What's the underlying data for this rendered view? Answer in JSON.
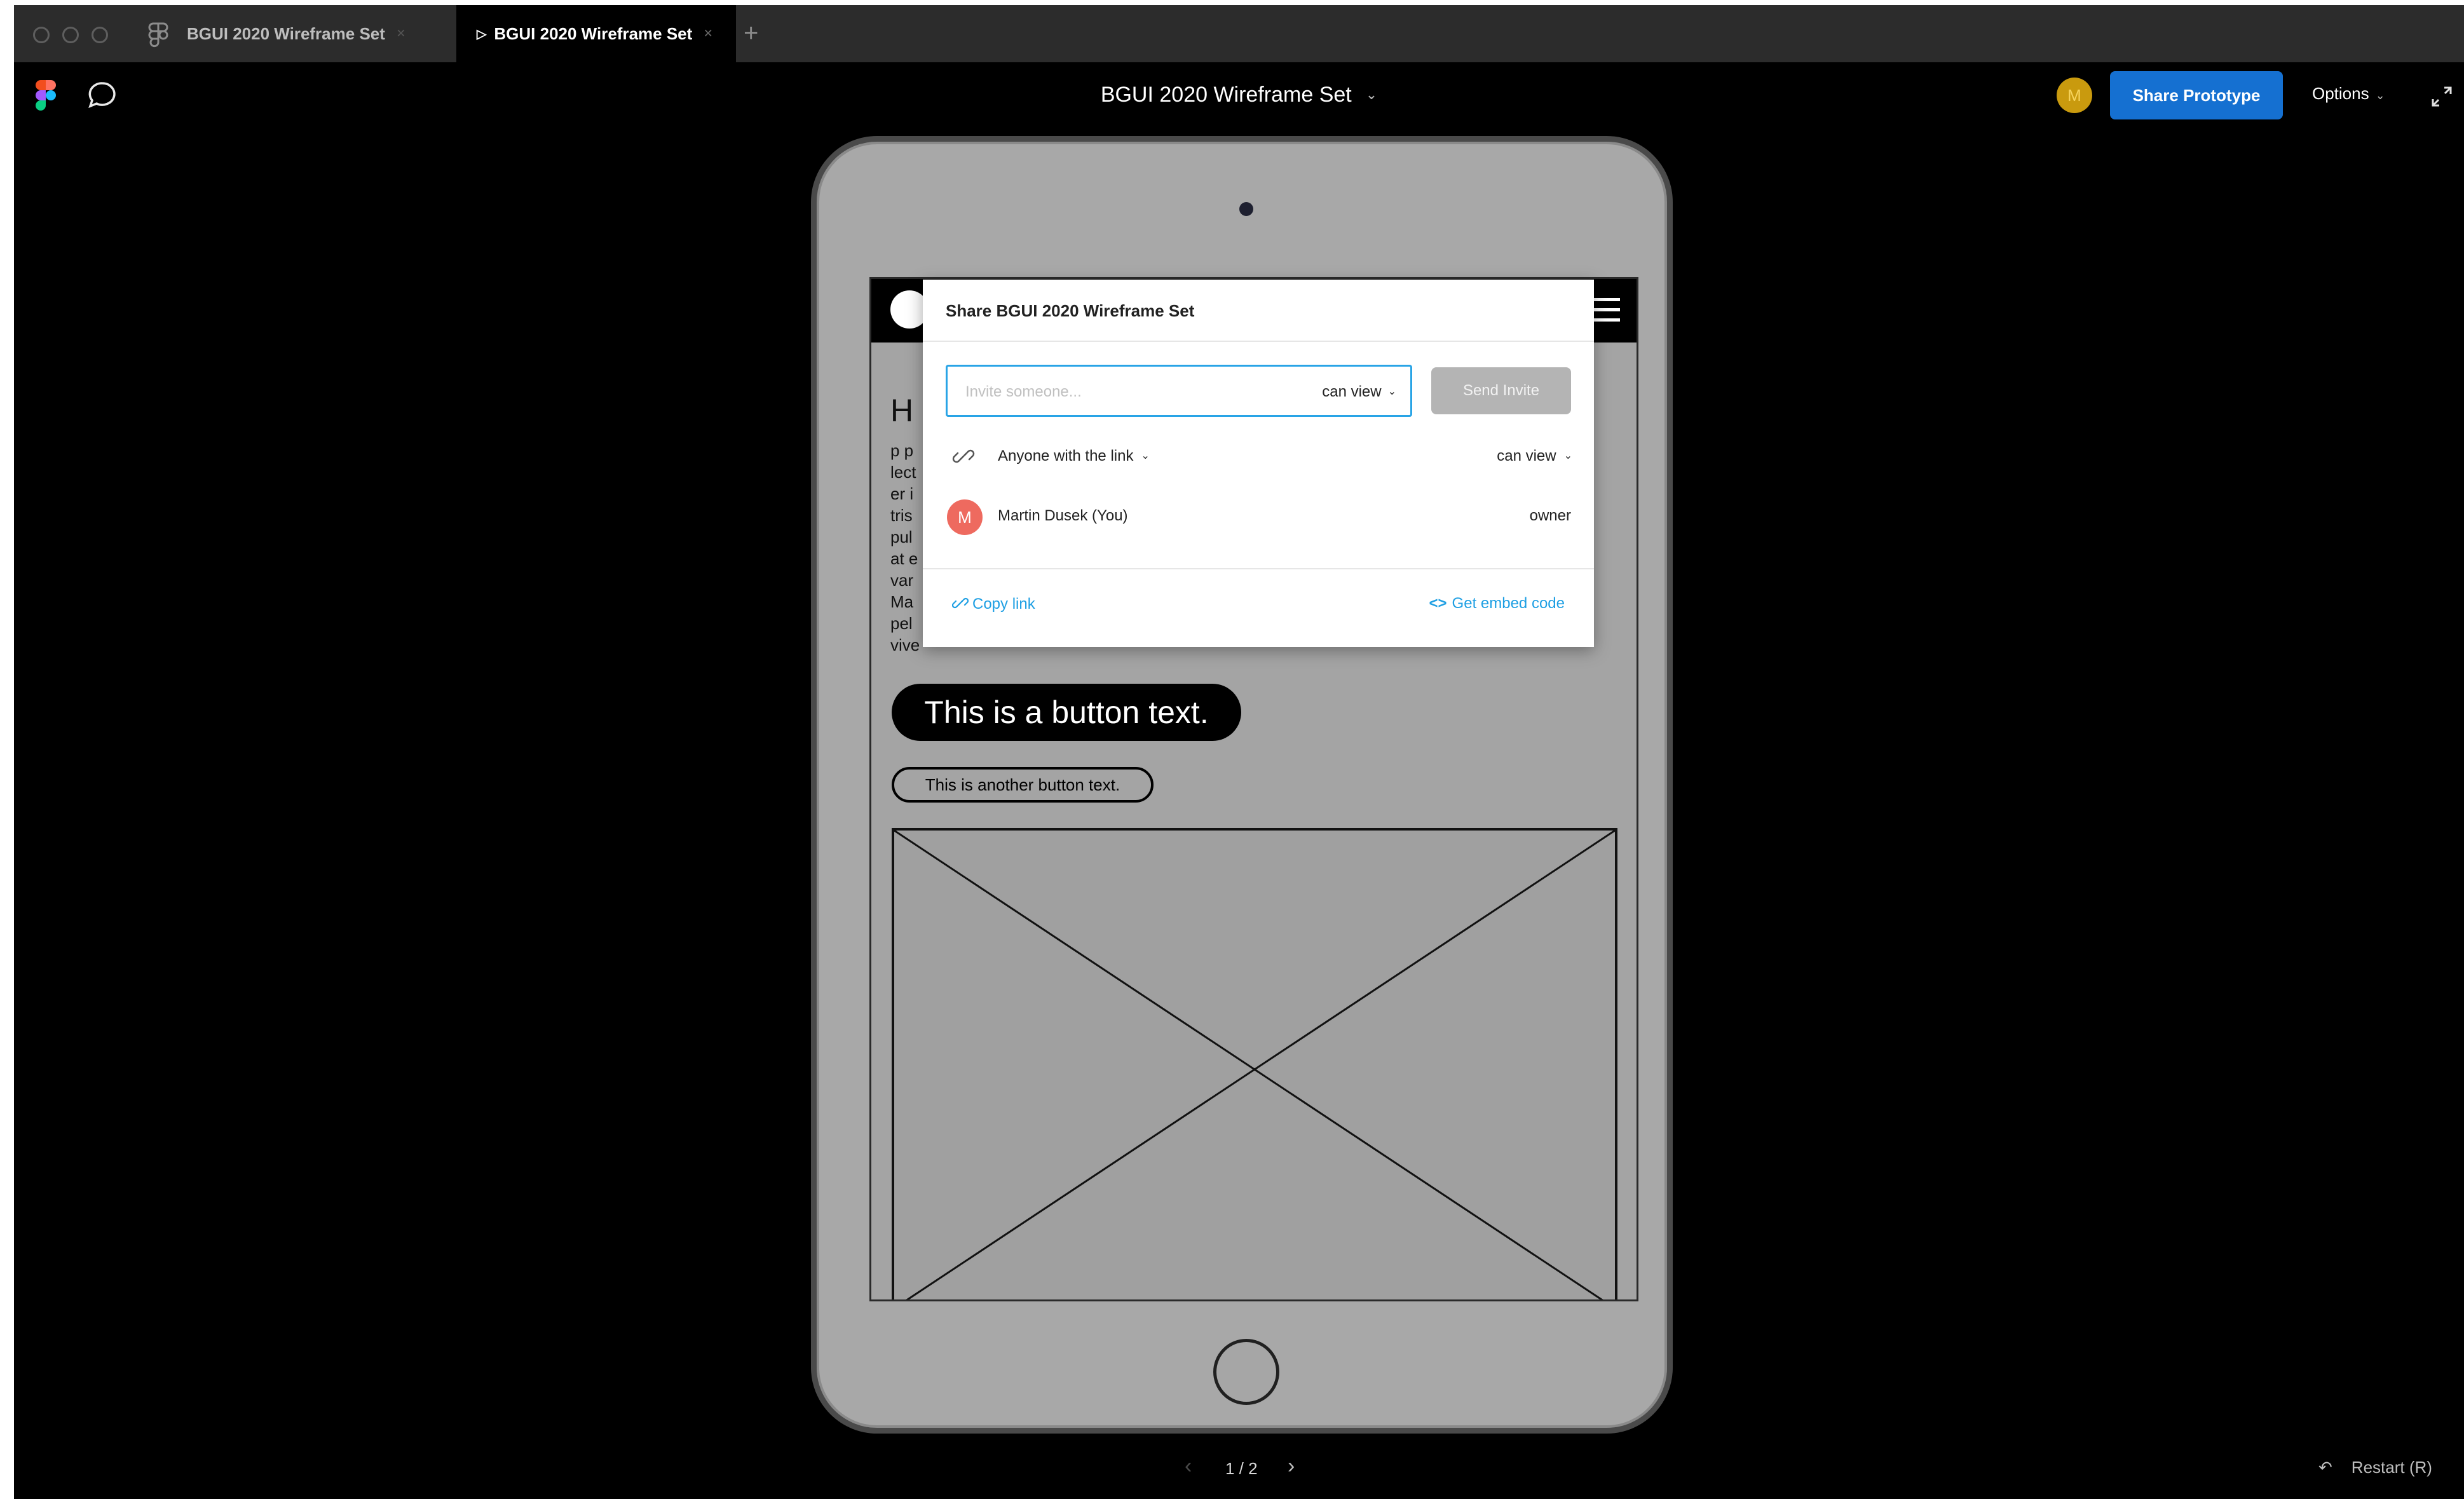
{
  "tabs": [
    {
      "label": "BGUI 2020 Wireframe Set",
      "close": "×"
    },
    {
      "label": "BGUI 2020 Wireframe Set",
      "close": "×",
      "active": true
    }
  ],
  "new_tab": "+",
  "toolbar": {
    "file_title": "BGUI 2020 Wireframe Set",
    "user_initial": "M",
    "share_label": "Share Prototype",
    "options_label": "Options"
  },
  "wireframe": {
    "heading": "H",
    "body_lines": [
      "p p",
      "lect",
      "er i",
      "tris",
      "pul",
      "at e",
      "var",
      "Ma",
      "pel",
      "vive"
    ],
    "primary_button": "This is a button text.",
    "secondary_button": "This is another button text."
  },
  "share_modal": {
    "title": "Share BGUI 2020 Wireframe Set",
    "invite_placeholder": "Invite someone...",
    "invite_permission": "can view",
    "send_invite": "Send Invite",
    "link_access": "Anyone with the link",
    "link_permission": "can view",
    "member": {
      "initial": "M",
      "name": "Martin Dusek (You)",
      "role": "owner"
    },
    "copy_link": "Copy link",
    "embed_code": "Get embed code"
  },
  "footer": {
    "page_indicator": "1 / 2",
    "restart": "Restart (R)"
  },
  "colors": {
    "accent": "#1570d1",
    "link": "#1e9fe3",
    "user_avatar": "#c99a0e",
    "member_avatar": "#ee6a5f"
  },
  "icons": [
    "figma-file-icon",
    "figma-logo-icon",
    "comment-icon",
    "expand-icon",
    "link-icon",
    "code-icon",
    "hamburger-icon",
    "restart-icon"
  ]
}
